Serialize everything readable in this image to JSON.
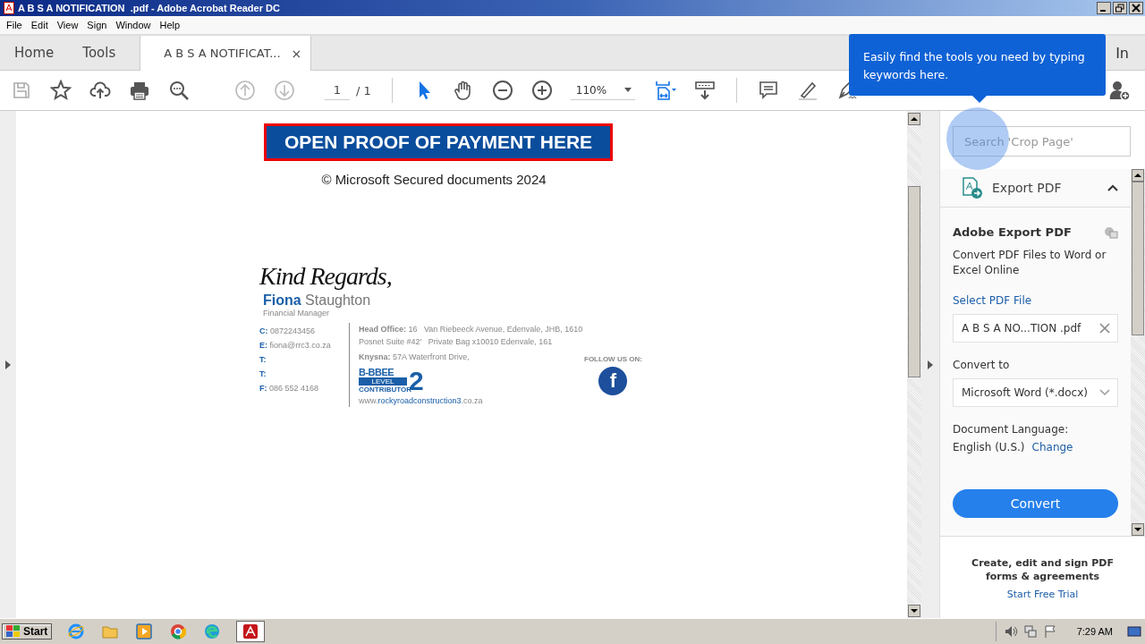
{
  "title_bar": {
    "title": "A B S A NOTIFICATION  .pdf - Adobe Acrobat Reader DC"
  },
  "menu": [
    "File",
    "Edit",
    "View",
    "Sign",
    "Window",
    "Help"
  ],
  "tabs": [
    {
      "label": "Home",
      "selected": false
    },
    {
      "label": "Tools",
      "selected": false
    },
    {
      "label": "A B S A NOTIFICAT...",
      "selected": true,
      "close": "×"
    }
  ],
  "sign_in": "In",
  "toolbar": {
    "page": "1",
    "page_total": "/ 1",
    "zoom": "110%"
  },
  "tooltip": {
    "text": "Easily find the tools you need by typing keywords here."
  },
  "document": {
    "banner": "OPEN PROOF OF PAYMENT HERE",
    "copyright": "© Microsoft Secured documents 2024",
    "closing": "Kind Regards,",
    "first_name": "Fiona",
    "last_name": "Staughton",
    "role": "Financial Manager",
    "contacts": [
      {
        "label": "C:",
        "value": "0872243456"
      },
      {
        "label": "E:",
        "value": "fiona@rrc3.co.za"
      },
      {
        "label": "T:"
      },
      {
        "label": "T:"
      },
      {
        "label": "F:",
        "value": "086 552 4168"
      }
    ],
    "head_office": [
      "**Head Office:** 16   Van Riebeeck Avenue, Edenvale, JHB, 1610",
      "Posnet Suite #42'   Private Bag x10010 Edenvale, 161"
    ],
    "branch": "**Knysna:** 57A Waterfront Drive,",
    "bbbee": {
      "top": "B-BBEE",
      "level": "LEVEL",
      "contributor": "CONTRIBUTOR",
      "number": "2"
    },
    "website": [
      "www.",
      "rockyroadconstruction3",
      ".co.za"
    ],
    "follow": "FOLLOW US ON:",
    "social": "f"
  },
  "search": {
    "placeholder": "Search 'Crop Page'"
  },
  "panel": {
    "header": "Export PDF",
    "expanded": true,
    "title": "Adobe Export PDF",
    "description": "Convert PDF Files to Word or Excel Online",
    "select_link": "Select PDF File",
    "file": "A B S A NO...TION .pdf",
    "convert_to_label": "Convert to",
    "format": "Microsoft Word (*.docx)",
    "language_label": "Document Language:",
    "language": "English (U.S.)",
    "change_link": "Change",
    "convert_button": "Convert"
  },
  "promo": {
    "text": "Create, edit and sign PDF forms & agreements",
    "link": "Start Free Trial"
  },
  "taskbar": {
    "start": "Start",
    "apps": [
      {
        "kind": "ie",
        "selected": false
      },
      {
        "kind": "folder",
        "selected": false
      },
      {
        "kind": "media",
        "selected": false
      },
      {
        "kind": "chrome",
        "selected": false
      },
      {
        "kind": "edge",
        "selected": false
      },
      {
        "kind": "acrobat",
        "selected": true
      }
    ],
    "time": "7:29 AM"
  }
}
